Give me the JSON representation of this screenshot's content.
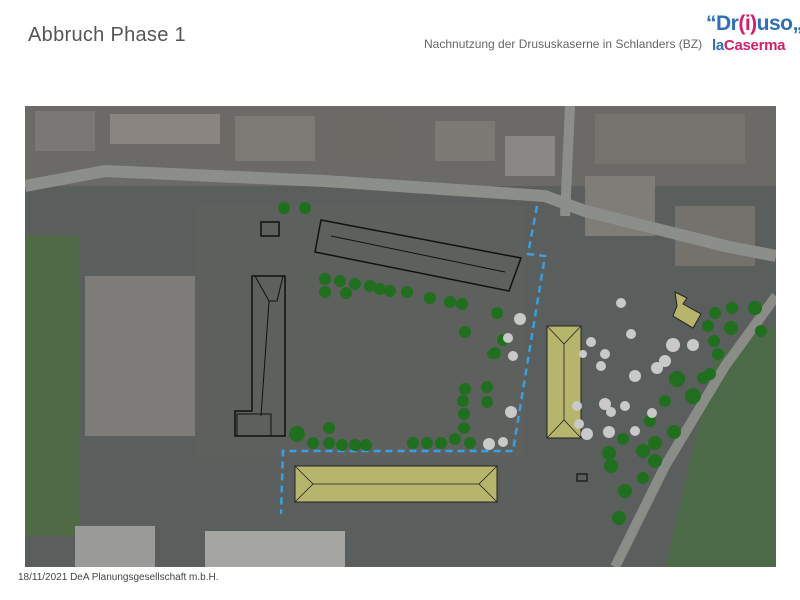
{
  "header": {
    "title": "Abbruch Phase 1",
    "subtitle": "Nachnutzung der Drususkaserne in Schlanders (BZ)"
  },
  "logo": {
    "line1": "“Dr(i)uso„",
    "line2": "laCaserma"
  },
  "footer": {
    "text": "18/11/2021 DeA Planungsgesellschaft m.b.H."
  },
  "colors": {
    "accent_blue": "#2e6fb8",
    "accent_magenta": "#d0206e",
    "boundary_line": "#3aa0e0",
    "building_fill": "#b8b86a",
    "tree_green": "#1f6f1f",
    "tree_light": "#c8c8c8"
  },
  "map": {
    "description_icons": [
      "demolition-outline",
      "retained-building",
      "tree-retained",
      "tree-removed",
      "boundary-dashed"
    ]
  }
}
